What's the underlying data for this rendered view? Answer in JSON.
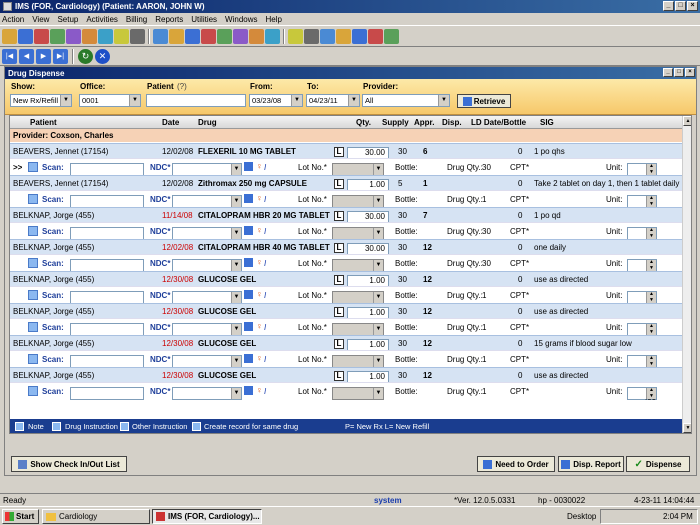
{
  "app": {
    "title": "IMS (FOR, Cardiology)    (Patient: AARON, JOHN W)"
  },
  "menu": [
    "Action",
    "View",
    "Setup",
    "Activities",
    "Billing",
    "Reports",
    "Utilities",
    "Windows",
    "Help"
  ],
  "toolbar_icons": [
    "user-icon",
    "patients-icon",
    "calendar-icon",
    "note-icon",
    "phone-icon",
    "doc-icon",
    "rx-icon",
    "lab-icon",
    "chart-icon",
    "flask-icon",
    "x-ray-icon",
    "letter-icon",
    "cog-icon",
    "clock-icon",
    "people-icon",
    "bell-icon",
    "report-icon",
    "list-icon",
    "money-icon",
    "card-icon",
    "ledger-icon",
    "lock-icon",
    "help-icon",
    "exit-icon"
  ],
  "child": {
    "title": "Drug Dispense"
  },
  "filter": {
    "show_label": "Show:",
    "show_value": "New Rx/Refill",
    "office_label": "Office:",
    "office_value": "0001",
    "patient_label": "Patient",
    "patient_hint": "(?)",
    "from_label": "From:",
    "from_value": "03/23/08",
    "to_label": "To:",
    "to_value": "04/23/11",
    "provider_label": "Provider:",
    "provider_value": "All",
    "retrieve_label": "Retrieve"
  },
  "grid": {
    "headers": {
      "patient": "Patient",
      "date": "Date",
      "drug": "Drug",
      "qty": "Qty.",
      "supply": "Supply",
      "appr": "Appr.",
      "disp": "Disp.",
      "ld": "LD Date/Bottle",
      "sig": "SIG"
    },
    "provider_row": "Provider:  Coxson, Charles",
    "rows": [
      {
        "patient": "BEAVERS, Jennet  (17154)",
        "date": "12/02/08",
        "date_red": false,
        "drug": "FLEXERIL 10 MG TABLET",
        "qty": "30.00",
        "supply": "30",
        "appr": "6",
        "disp": "",
        "bottles": "0",
        "sig": "1 po qhs",
        "drug_qty": "30",
        "marker": ">>"
      },
      {
        "patient": "BEAVERS, Jennet  (17154)",
        "date": "12/02/08",
        "date_red": false,
        "drug": "Zithromax 250 mg CAPSULE",
        "qty": "1.00",
        "supply": "5",
        "appr": "1",
        "disp": "",
        "bottles": "0",
        "sig": "Take 2 tablet on day 1, then 1 tablet daily o",
        "drug_qty": "1",
        "marker": ""
      },
      {
        "patient": "BELKNAP, Jorge  (455)",
        "date": "11/14/08",
        "date_red": true,
        "drug": "CITALOPRAM HBR 20 MG TABLET",
        "qty": "30.00",
        "supply": "30",
        "appr": "7",
        "disp": "",
        "bottles": "0",
        "sig": "1 po qd",
        "drug_qty": "30",
        "marker": ""
      },
      {
        "patient": "BELKNAP, Jorge  (455)",
        "date": "12/02/08",
        "date_red": true,
        "drug": "CITALOPRAM HBR 40 MG TABLET",
        "qty": "30.00",
        "supply": "30",
        "appr": "12",
        "disp": "",
        "bottles": "0",
        "sig": "one daily",
        "drug_qty": "30",
        "marker": ""
      },
      {
        "patient": "BELKNAP, Jorge  (455)",
        "date": "12/30/08",
        "date_red": true,
        "drug": "GLUCOSE GEL",
        "qty": "1.00",
        "supply": "30",
        "appr": "12",
        "disp": "",
        "bottles": "0",
        "sig": "use as directed",
        "drug_qty": "1",
        "marker": ""
      },
      {
        "patient": "BELKNAP, Jorge  (455)",
        "date": "12/30/08",
        "date_red": true,
        "drug": "GLUCOSE GEL",
        "qty": "1.00",
        "supply": "30",
        "appr": "12",
        "disp": "",
        "bottles": "0",
        "sig": "use as directed",
        "drug_qty": "1",
        "marker": ""
      },
      {
        "patient": "BELKNAP, Jorge  (455)",
        "date": "12/30/08",
        "date_red": true,
        "drug": "GLUCOSE GEL",
        "qty": "1.00",
        "supply": "30",
        "appr": "12",
        "disp": "",
        "bottles": "0",
        "sig": "15 grams if blood sugar low",
        "drug_qty": "1",
        "marker": ""
      },
      {
        "patient": "BELKNAP, Jorge  (455)",
        "date": "12/30/08",
        "date_red": true,
        "drug": "GLUCOSE GEL",
        "qty": "1.00",
        "supply": "30",
        "appr": "12",
        "disp": "",
        "bottles": "0",
        "sig": "use as directed",
        "drug_qty": "1",
        "marker": ""
      }
    ],
    "sub": {
      "scan": "Scan:",
      "ndc": "NDC*",
      "lot": "Lot No.*",
      "bottle": "Bottle:",
      "drug_qty_label": "Drug Qty.:",
      "cpt": "CPT*",
      "unit": "Unit:",
      "unit_value": ".00"
    },
    "legend": {
      "note": "Note",
      "drug_instr": "Drug Instruction",
      "other_instr": "Other Instruction",
      "create": "Create record for same drug",
      "keys": "P= New Rx   L= New Refill"
    }
  },
  "buttons": {
    "checkinout": "Show Check In/Out List",
    "need_to_order": "Need to Order",
    "disp_report": "Disp. Report",
    "dispense": "Dispense"
  },
  "status": {
    "ready": "Ready",
    "user": "system",
    "version": "*Ver. 12.0.5.0331",
    "host": "hp - 0030022",
    "datetime": "4-23-11 14:04:44"
  },
  "taskbar": {
    "start": "Start",
    "task1": "Cardiology",
    "task2": "IMS (FOR, Cardiology)...",
    "desktop": "Desktop",
    "clock": "2:04 PM"
  },
  "colors": {
    "title": "#0a246a",
    "red_date": "#cc0000",
    "filter_bg": "#f6c86a",
    "row_bg": "#d6e3f3"
  }
}
